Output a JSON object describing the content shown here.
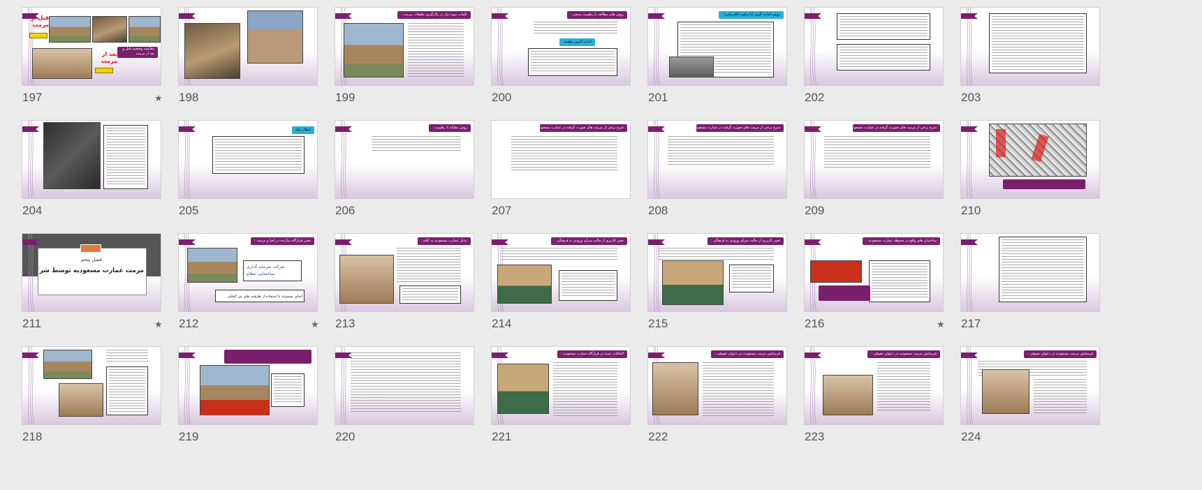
{
  "slides": [
    {
      "number": "197",
      "starred": true,
      "labels": {
        "top": "قبل از مرمت",
        "bottom": "بعد از مرمت",
        "caption": "مقایسه وضعیت قبل و بعد از مرمت"
      }
    },
    {
      "number": "198",
      "starred": false
    },
    {
      "number": "199",
      "starred": false,
      "title": "کلمات مورد نیاز در بکارگیری تعلیقات مرمت :"
    },
    {
      "number": "200",
      "starred": false,
      "title": "روش های مطالعه یا رطوبت سنجی :",
      "sub_title": "اندازه گیری رطوبت"
    },
    {
      "number": "201",
      "starred": false,
      "title": "روش اندازه گیری (با ترکیب الکتریکی) :"
    },
    {
      "number": "202",
      "starred": false
    },
    {
      "number": "203",
      "starred": false
    },
    {
      "number": "204",
      "starred": false
    },
    {
      "number": "205",
      "starred": false,
      "title": "انتقال نمک"
    },
    {
      "number": "206",
      "starred": false,
      "title": "روش مقابله با رطوبت :"
    },
    {
      "number": "207",
      "starred": false,
      "title": "شرح برخی از مرمت های صورت گرفته در عمارت مسعودیه :"
    },
    {
      "number": "208",
      "starred": false,
      "title": "شرح برخی از مرمت های صورت گرفته در عمارت مسعودیه :"
    },
    {
      "number": "209",
      "starred": false,
      "title": "شرح برخی از مرمت های صورت گرفته در عمارت مسعودیه :"
    },
    {
      "number": "210",
      "starred": false
    },
    {
      "number": "211",
      "starred": true,
      "section": {
        "subtitle": "فصل پنجم",
        "title": "مرمت عمارت مسعودیه توسط شرکت عظام"
      }
    },
    {
      "number": "212",
      "starred": true,
      "title": "نقش قرارگاه سازنده در احیا و مرمت :",
      "logo": {
        "line1": "شرکت سرمایه گذاری",
        "line2": "ساختمانی عظام"
      },
      "caption": "احیای مجموعه با استفاده از ظرفیت های بین المللی"
    },
    {
      "number": "213",
      "starred": false,
      "title": "تبدیل عمارت مسعودیه به کافه :"
    },
    {
      "number": "214",
      "starred": false,
      "title": "تغییر کاربری از حالت سرای ورودی به فرهنگی :"
    },
    {
      "number": "215",
      "starred": false,
      "title": "تغییر کاربری از حالت سرای ورودی به فرهنگی :"
    },
    {
      "number": "216",
      "starred": true,
      "title": "ساختمان های واقع در محوطه عمارت مسعودیه :"
    },
    {
      "number": "217",
      "starred": false
    },
    {
      "number": "218",
      "starred": false
    },
    {
      "number": "219",
      "starred": false
    },
    {
      "number": "220",
      "starred": false
    },
    {
      "number": "221",
      "starred": false,
      "title": "الحاقات جدید در قرارگاه عمارت مسعودیه :"
    },
    {
      "number": "222",
      "starred": false,
      "title": "فرسایش مرمت مسعودیه در دعوای حقوقی :"
    },
    {
      "number": "223",
      "starred": false,
      "title": "فرسایش مرمت مسعودیه در دعوای حقوقی :"
    },
    {
      "number": "224",
      "starred": false,
      "title": "فرسایش مرمت مسعودیه در دعوای حقوقی :"
    }
  ],
  "star_glyph": "★",
  "colors": {
    "accent": "#7a1f6e",
    "cyan": "#27b0d8",
    "background": "#ebebeb"
  }
}
